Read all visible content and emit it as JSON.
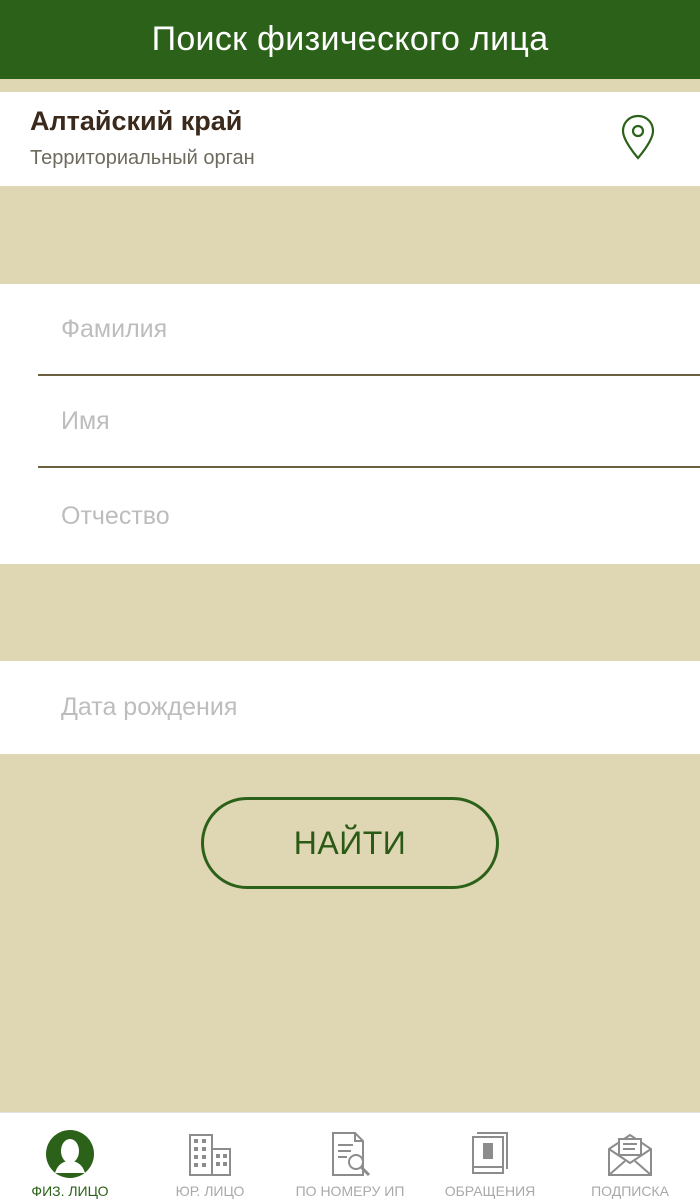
{
  "header": {
    "title": "Поиск физического лица"
  },
  "region": {
    "name": "Алтайский край",
    "subtitle": "Территориальный орган",
    "icon": "location-pin-icon"
  },
  "form": {
    "last_name": {
      "placeholder": "Фамилия",
      "value": ""
    },
    "first_name": {
      "placeholder": "Имя",
      "value": ""
    },
    "patronymic": {
      "placeholder": "Отчество",
      "value": ""
    },
    "birth_date": {
      "placeholder": "Дата рождения",
      "value": ""
    },
    "submit_label": "НАЙТИ"
  },
  "tabs": [
    {
      "label": "ФИЗ. ЛИЦО",
      "icon": "person-icon",
      "active": true
    },
    {
      "label": "ЮР. ЛИЦО",
      "icon": "building-icon",
      "active": false
    },
    {
      "label": "ПО НОМЕРУ ИП",
      "icon": "document-search-icon",
      "active": false
    },
    {
      "label": "ОБРАЩЕНИЯ",
      "icon": "book-icon",
      "active": false
    },
    {
      "label": "ПОДПИСКА",
      "icon": "envelope-icon",
      "active": false
    }
  ],
  "colors": {
    "primary": "#2b6118",
    "background": "#dfd7b3",
    "divider": "#6b6040",
    "tab_inactive": "#a9a9a9"
  }
}
